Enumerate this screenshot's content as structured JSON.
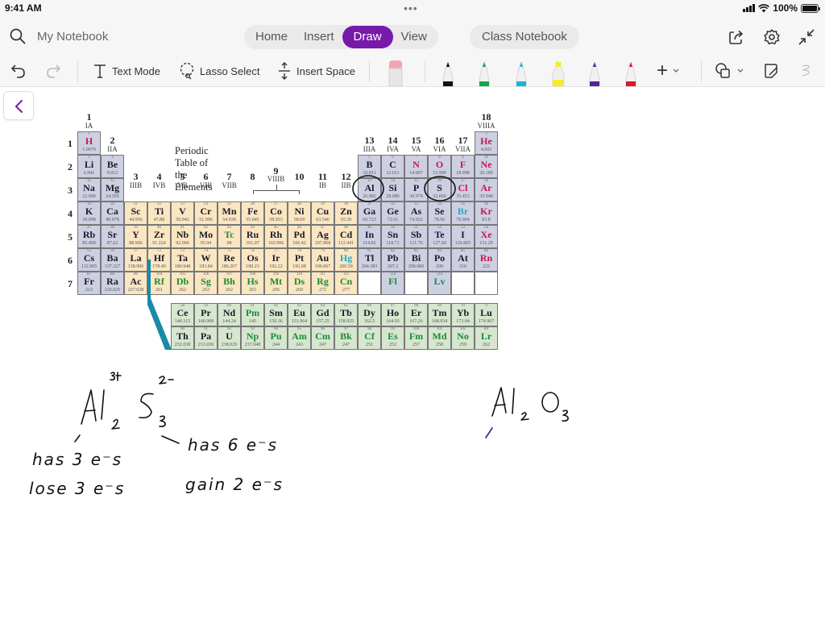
{
  "status_bar": {
    "time": "9:41 AM",
    "dots": "•••",
    "battery_label": "100%",
    "battery_level": 1.0
  },
  "nav": {
    "notebook_name": "My Notebook",
    "tabs": [
      {
        "label": "Home",
        "active": false
      },
      {
        "label": "Insert",
        "active": false
      },
      {
        "label": "Draw",
        "active": true
      },
      {
        "label": "View",
        "active": false
      }
    ],
    "class_notebook": "Class Notebook",
    "accent_color": "#7719aa",
    "icons": [
      "search-icon",
      "share-icon",
      "settings-gear-icon",
      "collapse-icon"
    ]
  },
  "toolbar": {
    "undo": "undo-icon",
    "redo": "redo-icon",
    "text_mode": "Text Mode",
    "lasso_select": "Lasso Select",
    "insert_space": "Insert Space",
    "pens": [
      {
        "name": "eraser",
        "color": "#f2a5b3"
      },
      {
        "name": "black-pen",
        "color": "#111111"
      },
      {
        "name": "green-pen",
        "color": "#1aa34a"
      },
      {
        "name": "cyan-pen",
        "color": "#1fb3d8"
      },
      {
        "name": "yellow-highlighter",
        "color": "#f4ec2a"
      },
      {
        "name": "purple-pen",
        "color": "#5a2296"
      },
      {
        "name": "red-pen",
        "color": "#d8192b"
      }
    ],
    "add_label": "+"
  },
  "periodic_table": {
    "title": "Periodic Table of the Elements",
    "groups": [
      {
        "num": "1",
        "sub": "IA",
        "col": 1
      },
      {
        "num": "2",
        "sub": "IIA",
        "col": 2
      },
      {
        "num": "3",
        "sub": "IIIB",
        "col": 3
      },
      {
        "num": "4",
        "sub": "IVB",
        "col": 4
      },
      {
        "num": "5",
        "sub": "VB",
        "col": 5
      },
      {
        "num": "6",
        "sub": "VIB",
        "col": 6
      },
      {
        "num": "7",
        "sub": "VIIB",
        "col": 7
      },
      {
        "num": "8",
        "sub": "",
        "col": 8
      },
      {
        "num": "9",
        "sub": "VIIIB",
        "col": 9
      },
      {
        "num": "10",
        "sub": "",
        "col": 10
      },
      {
        "num": "11",
        "sub": "IB",
        "col": 11
      },
      {
        "num": "12",
        "sub": "IIB",
        "col": 12
      },
      {
        "num": "13",
        "sub": "IIIA",
        "col": 13
      },
      {
        "num": "14",
        "sub": "IVA",
        "col": 14
      },
      {
        "num": "15",
        "sub": "VA",
        "col": 15
      },
      {
        "num": "16",
        "sub": "VIA",
        "col": 16
      },
      {
        "num": "17",
        "sub": "VIIA",
        "col": 17
      },
      {
        "num": "18",
        "sub": "VIIIA",
        "col": 18
      }
    ],
    "periods": [
      "1",
      "2",
      "3",
      "4",
      "5",
      "6",
      "7"
    ],
    "elements": [
      {
        "n": "1",
        "s": "H",
        "m": "1.0079",
        "r": 1,
        "c": 1,
        "t": "s",
        "col": "red"
      },
      {
        "n": "2",
        "s": "He",
        "m": "4.003",
        "r": 1,
        "c": 18,
        "t": "s",
        "col": "red"
      },
      {
        "n": "3",
        "s": "Li",
        "m": "6.941",
        "r": 2,
        "c": 1,
        "t": "s"
      },
      {
        "n": "4",
        "s": "Be",
        "m": "9.012",
        "r": 2,
        "c": 2,
        "t": "s"
      },
      {
        "n": "5",
        "s": "B",
        "m": "10.811",
        "r": 2,
        "c": 13,
        "t": "s"
      },
      {
        "n": "6",
        "s": "C",
        "m": "12.011",
        "r": 2,
        "c": 14,
        "t": "s"
      },
      {
        "n": "7",
        "s": "N",
        "m": "14.007",
        "r": 2,
        "c": 15,
        "t": "s",
        "col": "red"
      },
      {
        "n": "8",
        "s": "O",
        "m": "15.999",
        "r": 2,
        "c": 16,
        "t": "s",
        "col": "red"
      },
      {
        "n": "9",
        "s": "F",
        "m": "18.998",
        "r": 2,
        "c": 17,
        "t": "s",
        "col": "red"
      },
      {
        "n": "10",
        "s": "Ne",
        "m": "20.180",
        "r": 2,
        "c": 18,
        "t": "s",
        "col": "red"
      },
      {
        "n": "11",
        "s": "Na",
        "m": "22.990",
        "r": 3,
        "c": 1,
        "t": "s"
      },
      {
        "n": "12",
        "s": "Mg",
        "m": "24.305",
        "r": 3,
        "c": 2,
        "t": "s"
      },
      {
        "n": "13",
        "s": "Al",
        "m": "26.982",
        "r": 3,
        "c": 13,
        "t": "s"
      },
      {
        "n": "14",
        "s": "Si",
        "m": "28.086",
        "r": 3,
        "c": 14,
        "t": "s"
      },
      {
        "n": "15",
        "s": "P",
        "m": "30.974",
        "r": 3,
        "c": 15,
        "t": "s"
      },
      {
        "n": "16",
        "s": "S",
        "m": "32.066",
        "r": 3,
        "c": 16,
        "t": "s"
      },
      {
        "n": "17",
        "s": "Cl",
        "m": "35.453",
        "r": 3,
        "c": 17,
        "t": "s",
        "col": "red"
      },
      {
        "n": "18",
        "s": "Ar",
        "m": "39.948",
        "r": 3,
        "c": 18,
        "t": "s",
        "col": "red"
      },
      {
        "n": "19",
        "s": "K",
        "m": "39.098",
        "r": 4,
        "c": 1,
        "t": "s"
      },
      {
        "n": "20",
        "s": "Ca",
        "m": "40.078",
        "r": 4,
        "c": 2,
        "t": "s"
      },
      {
        "n": "21",
        "s": "Sc",
        "m": "44.956",
        "r": 4,
        "c": 3,
        "t": "d"
      },
      {
        "n": "22",
        "s": "Ti",
        "m": "47.88",
        "r": 4,
        "c": 4,
        "t": "d"
      },
      {
        "n": "23",
        "s": "V",
        "m": "50.942",
        "r": 4,
        "c": 5,
        "t": "d"
      },
      {
        "n": "24",
        "s": "Cr",
        "m": "51.996",
        "r": 4,
        "c": 6,
        "t": "d"
      },
      {
        "n": "25",
        "s": "Mn",
        "m": "54.938",
        "r": 4,
        "c": 7,
        "t": "d"
      },
      {
        "n": "26",
        "s": "Fe",
        "m": "55.845",
        "r": 4,
        "c": 8,
        "t": "d"
      },
      {
        "n": "27",
        "s": "Co",
        "m": "58.933",
        "r": 4,
        "c": 9,
        "t": "d"
      },
      {
        "n": "28",
        "s": "Ni",
        "m": "58.69",
        "r": 4,
        "c": 10,
        "t": "d"
      },
      {
        "n": "29",
        "s": "Cu",
        "m": "63.546",
        "r": 4,
        "c": 11,
        "t": "d"
      },
      {
        "n": "30",
        "s": "Zn",
        "m": "65.39",
        "r": 4,
        "c": 12,
        "t": "d"
      },
      {
        "n": "31",
        "s": "Ga",
        "m": "69.723",
        "r": 4,
        "c": 13,
        "t": "s"
      },
      {
        "n": "32",
        "s": "Ge",
        "m": "72.61",
        "r": 4,
        "c": 14,
        "t": "s"
      },
      {
        "n": "33",
        "s": "As",
        "m": "74.922",
        "r": 4,
        "c": 15,
        "t": "s"
      },
      {
        "n": "34",
        "s": "Se",
        "m": "78.96",
        "r": 4,
        "c": 16,
        "t": "s"
      },
      {
        "n": "35",
        "s": "Br",
        "m": "79.904",
        "r": 4,
        "c": 17,
        "t": "s",
        "col": "cyan"
      },
      {
        "n": "36",
        "s": "Kr",
        "m": "83.8",
        "r": 4,
        "c": 18,
        "t": "s",
        "col": "red"
      },
      {
        "n": "37",
        "s": "Rb",
        "m": "85.468",
        "r": 5,
        "c": 1,
        "t": "s"
      },
      {
        "n": "38",
        "s": "Sr",
        "m": "87.62",
        "r": 5,
        "c": 2,
        "t": "s"
      },
      {
        "n": "39",
        "s": "Y",
        "m": "88.906",
        "r": 5,
        "c": 3,
        "t": "d"
      },
      {
        "n": "40",
        "s": "Zr",
        "m": "91.224",
        "r": 5,
        "c": 4,
        "t": "d"
      },
      {
        "n": "41",
        "s": "Nb",
        "m": "92.906",
        "r": 5,
        "c": 5,
        "t": "d"
      },
      {
        "n": "42",
        "s": "Mo",
        "m": "95.94",
        "r": 5,
        "c": 6,
        "t": "d"
      },
      {
        "n": "43",
        "s": "Tc",
        "m": "98",
        "r": 5,
        "c": 7,
        "t": "d",
        "col": "green"
      },
      {
        "n": "44",
        "s": "Ru",
        "m": "101.07",
        "r": 5,
        "c": 8,
        "t": "d"
      },
      {
        "n": "45",
        "s": "Rh",
        "m": "102.906",
        "r": 5,
        "c": 9,
        "t": "d"
      },
      {
        "n": "46",
        "s": "Pd",
        "m": "106.42",
        "r": 5,
        "c": 10,
        "t": "d"
      },
      {
        "n": "47",
        "s": "Ag",
        "m": "107.868",
        "r": 5,
        "c": 11,
        "t": "d"
      },
      {
        "n": "48",
        "s": "Cd",
        "m": "112.441",
        "r": 5,
        "c": 12,
        "t": "d"
      },
      {
        "n": "49",
        "s": "In",
        "m": "114.82",
        "r": 5,
        "c": 13,
        "t": "s"
      },
      {
        "n": "50",
        "s": "Sn",
        "m": "118.71",
        "r": 5,
        "c": 14,
        "t": "s"
      },
      {
        "n": "51",
        "s": "Sb",
        "m": "121.76",
        "r": 5,
        "c": 15,
        "t": "s"
      },
      {
        "n": "52",
        "s": "Te",
        "m": "127.60",
        "r": 5,
        "c": 16,
        "t": "s"
      },
      {
        "n": "53",
        "s": "I",
        "m": "126.905",
        "r": 5,
        "c": 17,
        "t": "s"
      },
      {
        "n": "54",
        "s": "Xe",
        "m": "131.29",
        "r": 5,
        "c": 18,
        "t": "s",
        "col": "red"
      },
      {
        "n": "55",
        "s": "Cs",
        "m": "132.905",
        "r": 6,
        "c": 1,
        "t": "s"
      },
      {
        "n": "56",
        "s": "Ba",
        "m": "137.327",
        "r": 6,
        "c": 2,
        "t": "s"
      },
      {
        "n": "57",
        "s": "La",
        "m": "138.906",
        "r": 6,
        "c": 3,
        "t": "d"
      },
      {
        "n": "72",
        "s": "Hf",
        "m": "178.49",
        "r": 6,
        "c": 4,
        "t": "d"
      },
      {
        "n": "73",
        "s": "Ta",
        "m": "180.948",
        "r": 6,
        "c": 5,
        "t": "d"
      },
      {
        "n": "74",
        "s": "W",
        "m": "183.84",
        "r": 6,
        "c": 6,
        "t": "d"
      },
      {
        "n": "75",
        "s": "Re",
        "m": "186.207",
        "r": 6,
        "c": 7,
        "t": "d"
      },
      {
        "n": "76",
        "s": "Os",
        "m": "190.23",
        "r": 6,
        "c": 8,
        "t": "d"
      },
      {
        "n": "77",
        "s": "Ir",
        "m": "192.22",
        "r": 6,
        "c": 9,
        "t": "d"
      },
      {
        "n": "78",
        "s": "Pt",
        "m": "195.08",
        "r": 6,
        "c": 10,
        "t": "d"
      },
      {
        "n": "79",
        "s": "Au",
        "m": "196.967",
        "r": 6,
        "c": 11,
        "t": "d"
      },
      {
        "n": "80",
        "s": "Hg",
        "m": "200.59",
        "r": 6,
        "c": 12,
        "t": "d",
        "col": "cyan"
      },
      {
        "n": "81",
        "s": "Tl",
        "m": "204.383",
        "r": 6,
        "c": 13,
        "t": "s"
      },
      {
        "n": "82",
        "s": "Pb",
        "m": "207.2",
        "r": 6,
        "c": 14,
        "t": "s"
      },
      {
        "n": "83",
        "s": "Bi",
        "m": "208.980",
        "r": 6,
        "c": 15,
        "t": "s"
      },
      {
        "n": "84",
        "s": "Po",
        "m": "209",
        "r": 6,
        "c": 16,
        "t": "s"
      },
      {
        "n": "85",
        "s": "At",
        "m": "210",
        "r": 6,
        "c": 17,
        "t": "s"
      },
      {
        "n": "86",
        "s": "Rn",
        "m": "222",
        "r": 6,
        "c": 18,
        "t": "s",
        "col": "red"
      },
      {
        "n": "87",
        "s": "Fr",
        "m": "223",
        "r": 7,
        "c": 1,
        "t": "s"
      },
      {
        "n": "88",
        "s": "Ra",
        "m": "226.025",
        "r": 7,
        "c": 2,
        "t": "s"
      },
      {
        "n": "89",
        "s": "Ac",
        "m": "227.028",
        "r": 7,
        "c": 3,
        "t": "d"
      },
      {
        "n": "104",
        "s": "Rf",
        "m": "261",
        "r": 7,
        "c": 4,
        "t": "d",
        "col": "green"
      },
      {
        "n": "105",
        "s": "Db",
        "m": "262",
        "r": 7,
        "c": 5,
        "t": "d",
        "col": "green"
      },
      {
        "n": "106",
        "s": "Sg",
        "m": "263",
        "r": 7,
        "c": 6,
        "t": "d",
        "col": "green"
      },
      {
        "n": "107",
        "s": "Bh",
        "m": "262",
        "r": 7,
        "c": 7,
        "t": "d",
        "col": "green"
      },
      {
        "n": "108",
        "s": "Hs",
        "m": "265",
        "r": 7,
        "c": 8,
        "t": "d",
        "col": "green"
      },
      {
        "n": "109",
        "s": "Mt",
        "m": "266",
        "r": 7,
        "c": 9,
        "t": "d",
        "col": "green"
      },
      {
        "n": "110",
        "s": "Ds",
        "m": "269",
        "r": 7,
        "c": 10,
        "t": "d",
        "col": "green"
      },
      {
        "n": "111",
        "s": "Rg",
        "m": "272",
        "r": 7,
        "c": 11,
        "t": "d",
        "col": "green"
      },
      {
        "n": "112",
        "s": "Cn",
        "m": "277",
        "r": 7,
        "c": 12,
        "t": "d",
        "col": "green"
      },
      {
        "n": "",
        "s": "",
        "m": "",
        "r": 7,
        "c": 13,
        "t": "e"
      },
      {
        "n": "114",
        "s": "Fl",
        "m": "",
        "r": 7,
        "c": 14,
        "t": "s",
        "col": "green"
      },
      {
        "n": "",
        "s": "",
        "m": "",
        "r": 7,
        "c": 15,
        "t": "e"
      },
      {
        "n": "116",
        "s": "Lv",
        "m": "",
        "r": 7,
        "c": 16,
        "t": "s",
        "col": "green"
      },
      {
        "n": "",
        "s": "",
        "m": "",
        "r": 7,
        "c": 17,
        "t": "e"
      },
      {
        "n": "",
        "s": "",
        "m": "",
        "r": 7,
        "c": 18,
        "t": "e"
      }
    ],
    "f_block": [
      {
        "n": "58",
        "s": "Ce",
        "m": "140.115",
        "r": 1,
        "c": 1
      },
      {
        "n": "59",
        "s": "Pr",
        "m": "140.908",
        "r": 1,
        "c": 2
      },
      {
        "n": "60",
        "s": "Nd",
        "m": "144.24",
        "r": 1,
        "c": 3
      },
      {
        "n": "61",
        "s": "Pm",
        "m": "145",
        "r": 1,
        "c": 4,
        "col": "green"
      },
      {
        "n": "62",
        "s": "Sm",
        "m": "150.36",
        "r": 1,
        "c": 5
      },
      {
        "n": "63",
        "s": "Eu",
        "m": "151.964",
        "r": 1,
        "c": 6
      },
      {
        "n": "64",
        "s": "Gd",
        "m": "157.25",
        "r": 1,
        "c": 7
      },
      {
        "n": "65",
        "s": "Tb",
        "m": "158.925",
        "r": 1,
        "c": 8
      },
      {
        "n": "66",
        "s": "Dy",
        "m": "162.5",
        "r": 1,
        "c": 9
      },
      {
        "n": "67",
        "s": "Ho",
        "m": "164.93",
        "r": 1,
        "c": 10
      },
      {
        "n": "68",
        "s": "Er",
        "m": "167.26",
        "r": 1,
        "c": 11
      },
      {
        "n": "69",
        "s": "Tm",
        "m": "168.934",
        "r": 1,
        "c": 12
      },
      {
        "n": "70",
        "s": "Yb",
        "m": "173.04",
        "r": 1,
        "c": 13
      },
      {
        "n": "71",
        "s": "Lu",
        "m": "174.967",
        "r": 1,
        "c": 14
      },
      {
        "n": "90",
        "s": "Th",
        "m": "232.038",
        "r": 2,
        "c": 1
      },
      {
        "n": "91",
        "s": "Pa",
        "m": "231.036",
        "r": 2,
        "c": 2
      },
      {
        "n": "92",
        "s": "U",
        "m": "238.029",
        "r": 2,
        "c": 3
      },
      {
        "n": "93",
        "s": "Np",
        "m": "237.048",
        "r": 2,
        "c": 4,
        "col": "green"
      },
      {
        "n": "94",
        "s": "Pu",
        "m": "244",
        "r": 2,
        "c": 5,
        "col": "green"
      },
      {
        "n": "95",
        "s": "Am",
        "m": "243",
        "r": 2,
        "c": 6,
        "col": "green"
      },
      {
        "n": "96",
        "s": "Cm",
        "m": "247",
        "r": 2,
        "c": 7,
        "col": "green"
      },
      {
        "n": "97",
        "s": "Bk",
        "m": "247",
        "r": 2,
        "c": 8,
        "col": "green"
      },
      {
        "n": "98",
        "s": "Cf",
        "m": "251",
        "r": 2,
        "c": 9,
        "col": "green"
      },
      {
        "n": "99",
        "s": "Es",
        "m": "252",
        "r": 2,
        "c": 10,
        "col": "green"
      },
      {
        "n": "100",
        "s": "Fm",
        "m": "257",
        "r": 2,
        "c": 11,
        "col": "green"
      },
      {
        "n": "101",
        "s": "Md",
        "m": "258",
        "r": 2,
        "c": 12,
        "col": "green"
      },
      {
        "n": "102",
        "s": "No",
        "m": "259",
        "r": 2,
        "c": 13,
        "col": "green"
      },
      {
        "n": "89",
        "s": "Lr",
        "m": "262",
        "r": 2,
        "c": 14,
        "col": "green"
      }
    ],
    "circled": [
      "Al",
      "S"
    ],
    "symbol_colors": {
      "red": "#c8174d",
      "cyan": "#27a9c9",
      "green": "#1b8a3a",
      "default": "#1a1a2a"
    }
  },
  "handwriting": {
    "formula_1": {
      "base": "Al",
      "sub1": "2",
      "anion": "S",
      "sub2": "3",
      "charge_al": "3+",
      "charge_s": "2-"
    },
    "notes_al": [
      "has 3 e⁻s",
      "lose 3 e⁻s"
    ],
    "notes_s": [
      "has 6 e⁻s",
      "gain 2 e⁻s"
    ],
    "formula_2": {
      "base": "Al",
      "sub1": "2",
      "anion": "O",
      "sub2": "3"
    },
    "ink_color": "#111111",
    "accent_ink_color": "#5a2296"
  }
}
